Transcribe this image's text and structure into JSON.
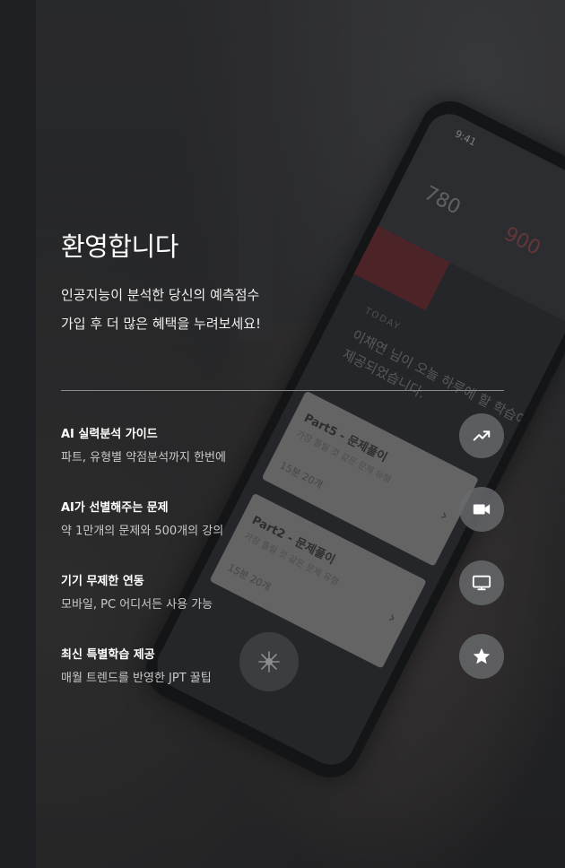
{
  "welcome": {
    "title": "환영합니다",
    "subtitle_line1": "인공지능이 분석한 당신의 예측점수",
    "subtitle_line2": "가입 후 더 많은 혜택을 누려보세요!"
  },
  "features": [
    {
      "title": "AI 실력분석 가이드",
      "description": "파트, 유형별 약점분석까지 한번에",
      "icon": "trend-up-icon"
    },
    {
      "title": "AI가 선별해주는 문제",
      "description": "약 1만개의 문제와 500개의 강의",
      "icon": "video-camera-icon"
    },
    {
      "title": "기기 무제한 연동",
      "description": "모바일, PC 어디서든 사용 가능",
      "icon": "monitor-icon"
    },
    {
      "title": "최신 특별학습 제공",
      "description": "매월 트렌드를 반영한 JPT 꿀팁",
      "icon": "star-icon"
    }
  ],
  "background_phone": {
    "time": "9:41",
    "score1": "780",
    "score2": "900",
    "today_label": "TODAY",
    "message": "이채연 님이 오늘 하루에 할 학습이 제공되었습니다.",
    "card1_title": "Part5 - 문제풀이",
    "card1_sub": "가장 틀릴 것 같은 문제 유형",
    "card1_meta": "15분   20개",
    "card2_title": "Part2 - 문제풀이",
    "card2_sub": "가장 틀릴 것 같은 문제 유형",
    "card2_meta": "15분   20개"
  },
  "colors": {
    "background": "#2a2b2d",
    "text_primary": "#ffffff",
    "text_secondary": "#c9c9c9",
    "icon_circle": "#69696c",
    "divider": "#8a8b8d"
  }
}
